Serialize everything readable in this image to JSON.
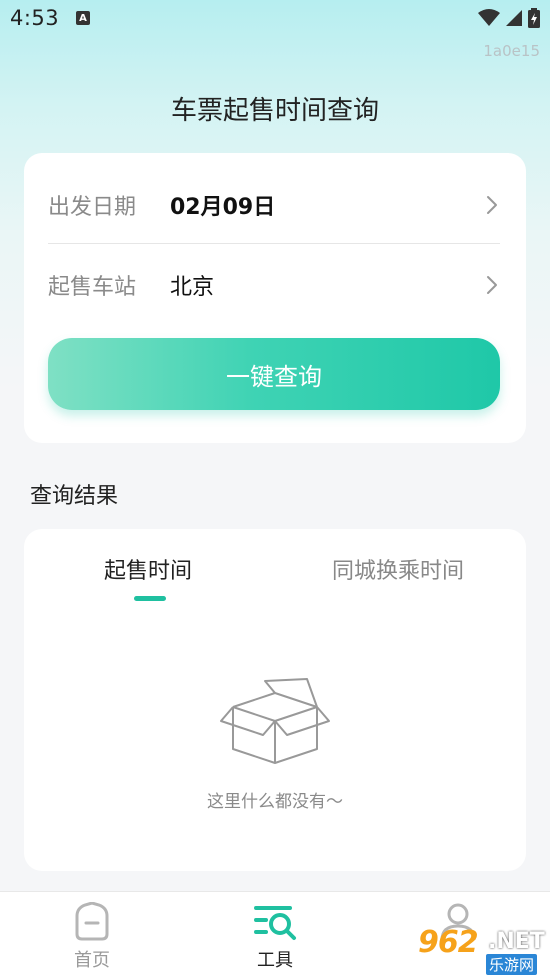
{
  "status_bar": {
    "time": "4:53",
    "notification_icon": "A",
    "icons": [
      "wifi-icon",
      "signal-icon",
      "battery-icon"
    ]
  },
  "version": "1a0e15",
  "page_title": "车票起售时间查询",
  "form": {
    "date_label": "出发日期",
    "date_value": "02月09日",
    "station_label": "起售车站",
    "station_value": "北京",
    "query_button": "一键查询"
  },
  "results": {
    "section_title": "查询结果",
    "tabs": [
      {
        "label": "起售时间",
        "active": true
      },
      {
        "label": "同城换乘时间",
        "active": false
      }
    ],
    "empty_text": "这里什么都没有～"
  },
  "tab_bar": {
    "items": [
      {
        "label": "首页",
        "icon": "home-icon",
        "active": false
      },
      {
        "label": "工具",
        "icon": "tools-search-icon",
        "active": true
      },
      {
        "label": "",
        "icon": "profile-icon",
        "active": false
      }
    ]
  },
  "watermark": {
    "number": "962",
    "suffix": ".NET",
    "chinese": "乐游网"
  },
  "colors": {
    "accent": "#1fc8a8",
    "background": "#f5f6f8",
    "header_gradient_top": "#b6eef0"
  }
}
